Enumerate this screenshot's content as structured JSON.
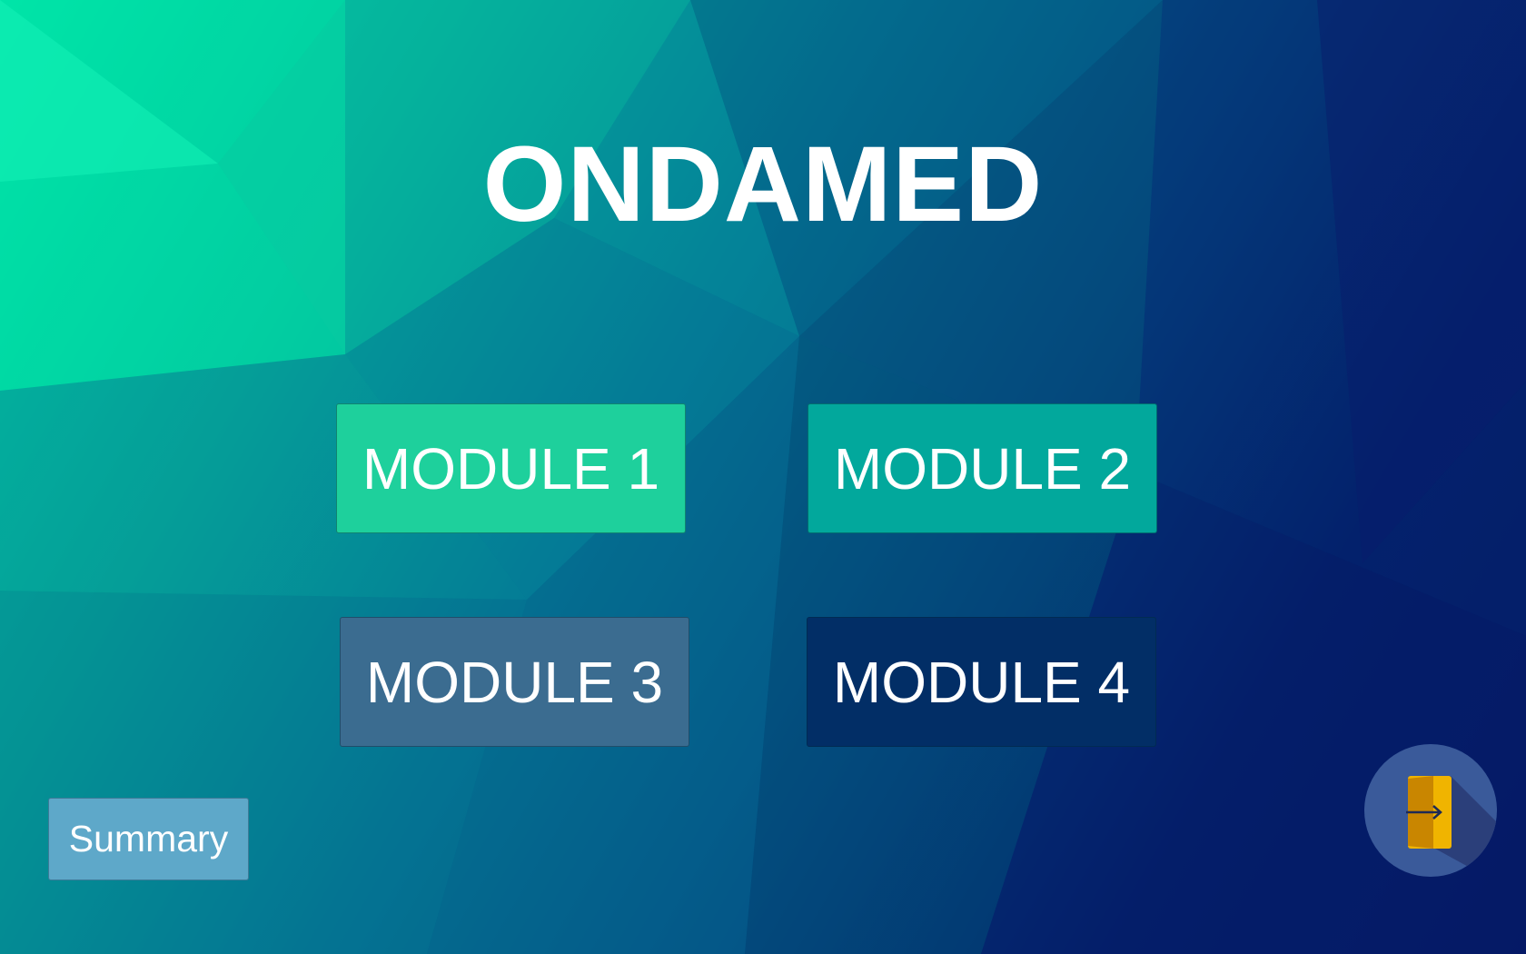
{
  "app": {
    "title": "ONDAMED"
  },
  "modules": [
    {
      "label": "MODULE 1",
      "color": "#1ed09c"
    },
    {
      "label": "MODULE 2",
      "color": "#02a89c"
    },
    {
      "label": "MODULE 3",
      "color": "#3b6c90"
    },
    {
      "label": "MODULE 4",
      "color": "#022e66"
    }
  ],
  "footer": {
    "summary_label": "Summary",
    "summary_color": "#5ea8c9",
    "exit_icon": "exit-door-icon",
    "exit_circle_color": "#3a5a9a",
    "exit_door_color": "#f0b400"
  }
}
